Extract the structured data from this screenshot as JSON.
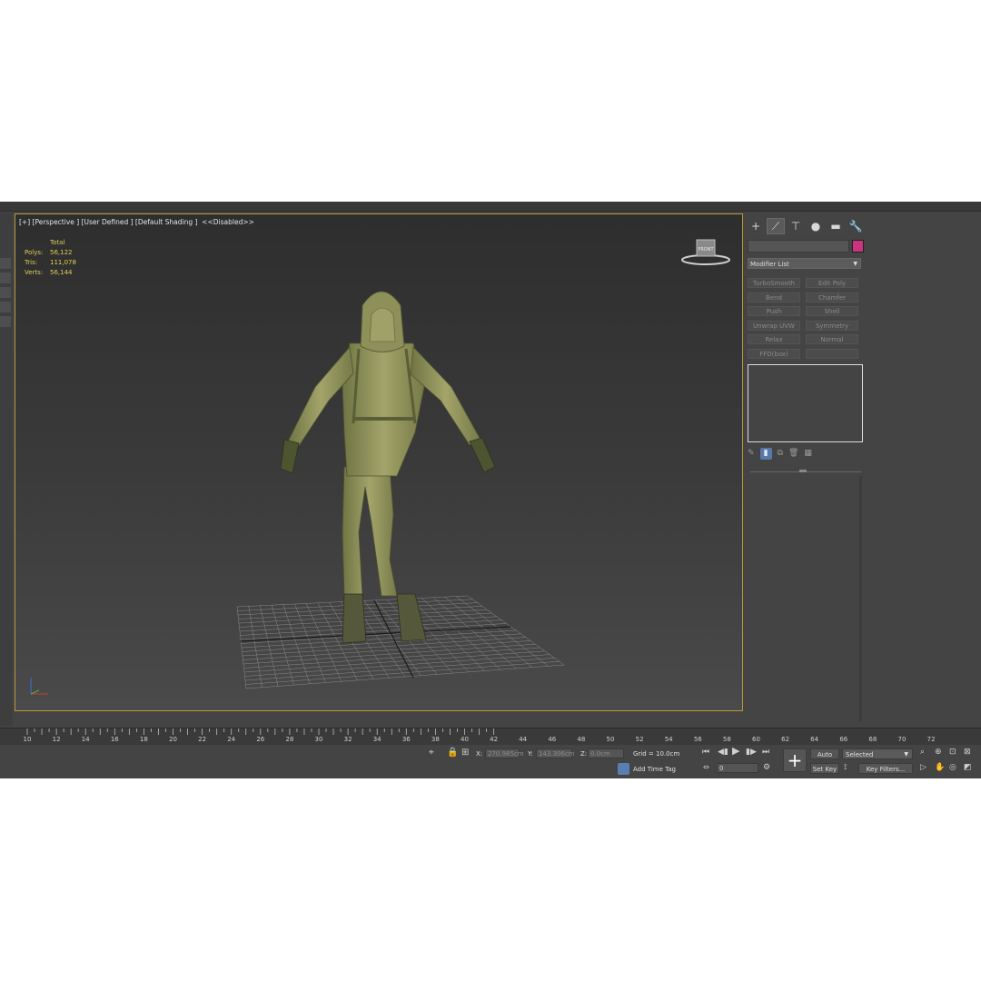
{
  "viewport": {
    "label": "[+] [Perspective ] [User Defined ] [Default Shading ]  <<Disabled>>",
    "stats": {
      "header": "Total",
      "rows": [
        {
          "key": "Polys:",
          "value": "56,122"
        },
        {
          "key": "Tris:",
          "value": "111,078"
        },
        {
          "key": "Verts:",
          "value": "56,144"
        }
      ]
    },
    "viewcube_face": "FRONT"
  },
  "command_panel": {
    "tabs": [
      {
        "icon": "create-icon",
        "glyph": "+"
      },
      {
        "icon": "modify-icon",
        "glyph": "⟋"
      },
      {
        "icon": "hierarchy-icon",
        "glyph": "⊤"
      },
      {
        "icon": "motion-icon",
        "glyph": "●"
      },
      {
        "icon": "display-icon",
        "glyph": "▬"
      },
      {
        "icon": "utilities-icon",
        "glyph": "🔧"
      }
    ],
    "color_swatch": "#c8347e",
    "modifier_list": "Modifier List",
    "modifier_buttons": [
      "TurboSmooth",
      "Edit Poly",
      "Bend",
      "Chamfer",
      "Push",
      "Shell",
      "Unwrap UVW",
      "Symmetry",
      "Relax",
      "Normal",
      "FFD(box)",
      ""
    ]
  },
  "timeline": {
    "ticks": [
      "10",
      "12",
      "14",
      "16",
      "18",
      "20",
      "22",
      "24",
      "26",
      "28",
      "30",
      "32",
      "34",
      "36",
      "38",
      "40",
      "42",
      "44",
      "46",
      "48",
      "50",
      "52",
      "54",
      "56",
      "58",
      "60",
      "62",
      "64",
      "66",
      "68",
      "70",
      "72"
    ]
  },
  "status_bar": {
    "x_label": "X:",
    "x_value": "270.985cm",
    "y_label": "Y:",
    "y_value": "143.306cm",
    "z_label": "Z:",
    "z_value": "0.0cm",
    "grid": "Grid = 10.0cm",
    "add_time_tag": "Add Time Tag",
    "frame_value": "0",
    "auto_key": "Auto Key",
    "selected": "Selected",
    "set_key": "Set Key",
    "key_filters": "Key Filters..."
  },
  "colors": {
    "viewport_border": "#b79a3a",
    "stats_text": "#e0cf55",
    "accent_blue": "#5879a8"
  }
}
